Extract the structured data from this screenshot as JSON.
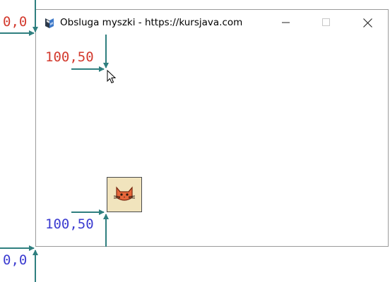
{
  "window": {
    "title": "Obsluga myszki - https://kursjava.com",
    "minimize_icon": "minimize-icon",
    "maximize_icon": "maximize-icon",
    "close_icon": "close-icon"
  },
  "annotations": {
    "origin_top_label": "0,0",
    "mouse_label": "100,50",
    "sprite_label": "100,50",
    "origin_bottom_label": "0,0",
    "colors": {
      "screen_coords": "#d33a2e",
      "window_coords": "#3b3bd0",
      "arrow": "#2f7f7f"
    }
  },
  "sprite": {
    "icon": "cat-face-icon",
    "background": "#f1e4bd"
  },
  "cursor": {
    "icon": "mouse-pointer-icon"
  }
}
